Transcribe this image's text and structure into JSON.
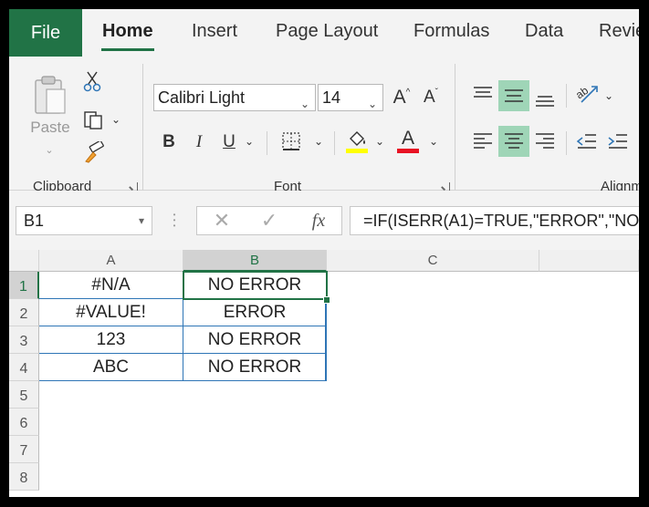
{
  "tabs": {
    "file": "File",
    "home": "Home",
    "insert": "Insert",
    "page_layout": "Page Layout",
    "formulas": "Formulas",
    "data": "Data",
    "review": "Revie"
  },
  "ribbon": {
    "clipboard": {
      "label": "Clipboard",
      "paste_label": "Paste"
    },
    "font": {
      "label": "Font",
      "font_name": "Calibri Light",
      "font_size": "14",
      "grow_font": "A",
      "shrink_font": "A",
      "bold": "B",
      "italic": "I",
      "underline": "U",
      "font_color_letter": "A",
      "fill_color": "#ffff00",
      "font_color": "#e81123"
    },
    "alignment": {
      "label": "Alignm"
    }
  },
  "formula_bar": {
    "name_box": "B1",
    "fx_label": "fx",
    "formula": "=IF(ISERR(A1)=TRUE,\"ERROR\",\"NO"
  },
  "grid": {
    "columns": [
      "A",
      "B",
      "C"
    ],
    "row_numbers": [
      "1",
      "2",
      "3",
      "4",
      "5",
      "6",
      "7",
      "8"
    ],
    "rows": [
      {
        "a": "#N/A",
        "b": "NO ERROR"
      },
      {
        "a": "#VALUE!",
        "b": "ERROR"
      },
      {
        "a": "123",
        "b": "NO ERROR"
      },
      {
        "a": "ABC",
        "b": "NO ERROR"
      }
    ],
    "selected_cell": "B1"
  },
  "colors": {
    "accent": "#217346",
    "table_border": "#2e75b6",
    "highlight": "#9fd5b7"
  }
}
